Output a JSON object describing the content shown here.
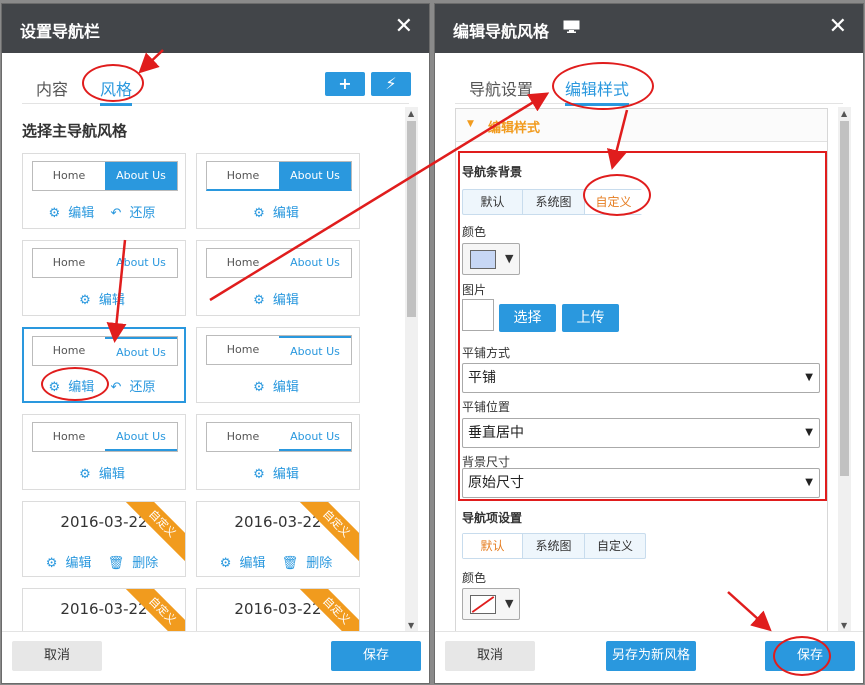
{
  "left_dialog": {
    "title": "设置导航栏",
    "close": "✕",
    "tabs": [
      "内容",
      "风格"
    ],
    "tools": [
      "+",
      "⚡"
    ],
    "section_title": "选择主导航风格",
    "cards": [
      {
        "home": "Home",
        "about": "About Us",
        "edit": "编辑",
        "restore": "还原"
      },
      {
        "home": "Home",
        "about": "About Us",
        "edit": "编辑"
      },
      {
        "home": "Home",
        "about": "About Us",
        "edit": "编辑"
      },
      {
        "home": "Home",
        "about": "About Us",
        "edit": "编辑"
      },
      {
        "home": "Home",
        "about": "About Us",
        "edit": "编辑",
        "restore": "还原"
      },
      {
        "home": "Home",
        "about": "About Us",
        "edit": "编辑"
      },
      {
        "home": "Home",
        "about": "About Us",
        "edit": "编辑"
      },
      {
        "home": "Home",
        "about": "About Us",
        "edit": "编辑"
      }
    ],
    "custom_cards": [
      {
        "date": "2016-03-22",
        "edit": "编辑",
        "delete": "删除",
        "ribbon": "自定义"
      },
      {
        "date": "2016-03-22",
        "edit": "编辑",
        "delete": "删除",
        "ribbon": "自定义"
      },
      {
        "date": "2016-03-22",
        "ribbon": "自定义"
      },
      {
        "date": "2016-03-22",
        "ribbon": "自定义"
      }
    ],
    "cancel": "取消",
    "save": "保存"
  },
  "right_dialog": {
    "title": "编辑导航风格",
    "close": "✕",
    "tabs": [
      "导航设置",
      "编辑样式"
    ],
    "panel_title": "编辑样式",
    "bg_section": "导航条背景",
    "bg_options": [
      "默认",
      "系统图",
      "自定义"
    ],
    "color_label": "颜色",
    "image_label": "图片",
    "select_btn": "选择",
    "upload_btn": "上传",
    "tile_mode_label": "平铺方式",
    "tile_mode_value": "平铺",
    "tile_pos_label": "平铺位置",
    "tile_pos_value": "垂直居中",
    "bg_size_label": "背景尺寸",
    "bg_size_value": "原始尺寸",
    "item_section": "导航项设置",
    "item_options": [
      "默认",
      "系统图",
      "自定义"
    ],
    "item_color_label": "颜色",
    "cancel": "取消",
    "save_as": "另存为新风格",
    "save": "保存"
  },
  "colors": {
    "accent": "#2a98de",
    "orange": "#f19b1e",
    "annotation": "#e01d1d",
    "titlebar": "#424549"
  }
}
